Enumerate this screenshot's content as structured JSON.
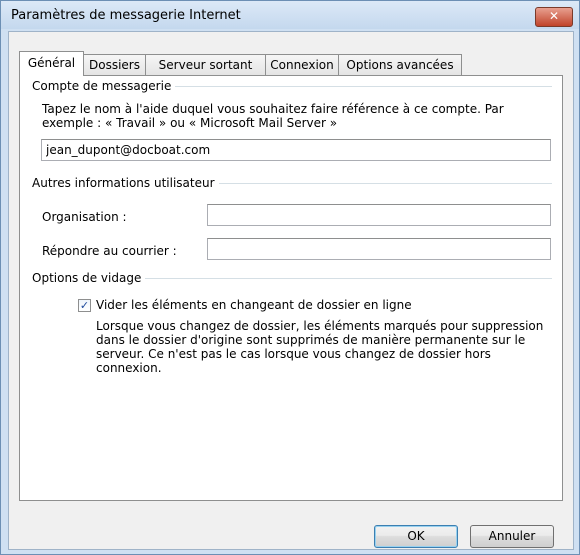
{
  "window": {
    "title": "Paramètres de messagerie Internet",
    "close_glyph": "✕"
  },
  "tabs": [
    {
      "label": "Général",
      "active": true
    },
    {
      "label": "Dossiers",
      "active": false
    },
    {
      "label": "Serveur sortant",
      "active": false
    },
    {
      "label": "Connexion",
      "active": false
    },
    {
      "label": "Options avancées",
      "active": false
    }
  ],
  "account": {
    "heading": "Compte de messagerie",
    "description_line1": "Tapez le nom à l'aide duquel vous souhaitez faire référence à ce compte. Par",
    "description_line2": "exemple : « Travail » ou « Microsoft Mail Server »",
    "value": "jean_dupont@docboat.com"
  },
  "user_info": {
    "heading": "Autres informations utilisateur",
    "organization_label": "Organisation :",
    "organization_value": "",
    "reply_label": "Répondre au courrier :",
    "reply_value": ""
  },
  "purge": {
    "heading": "Options de vidage",
    "checkbox_label": "Vider les éléments en changeant de dossier en ligne",
    "checked": true,
    "check_glyph": "✓",
    "desc_line1": "Lorsque vous changez de dossier, les éléments marqués pour suppression",
    "desc_line2": "dans le dossier d'origine sont supprimés de manière permanente sur le",
    "desc_line3": "serveur. Ce n'est pas le cas lorsque vous changez de dossier hors",
    "desc_line4": "connexion."
  },
  "buttons": {
    "ok": "OK",
    "cancel": "Annuler"
  }
}
